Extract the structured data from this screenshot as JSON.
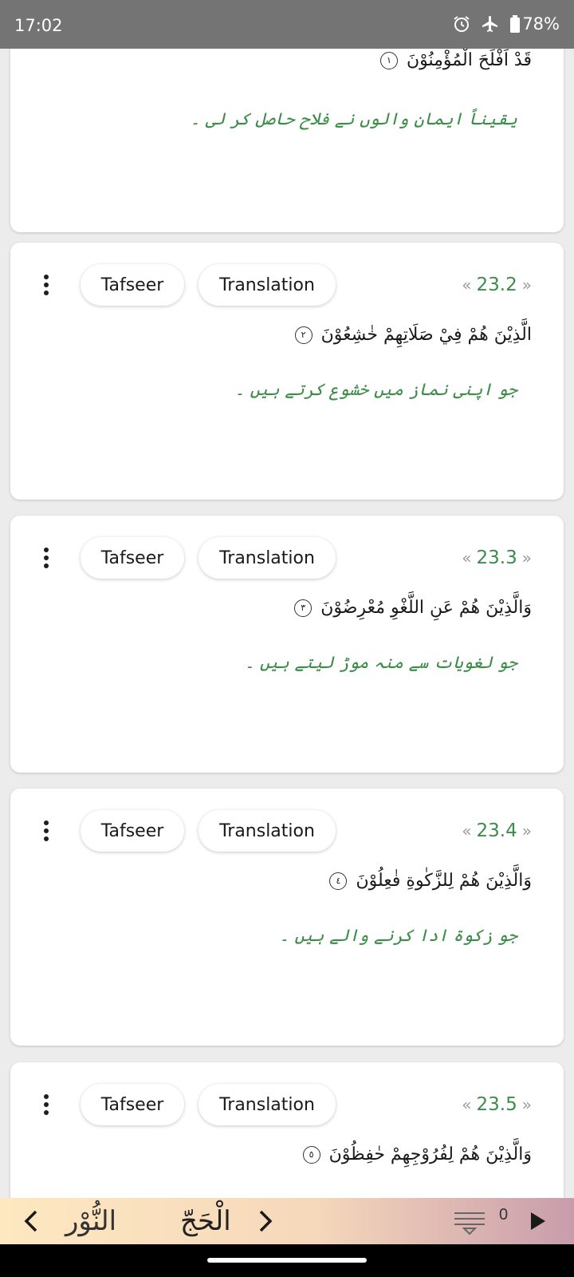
{
  "status_bar": {
    "time": "17:02",
    "battery": "78%",
    "icons": [
      "alarm-icon",
      "airplane-mode-icon",
      "battery-icon"
    ]
  },
  "colors": {
    "accent_green": "#3d8c4a",
    "status_bar_bg": "#747474",
    "page_bg": "#ececec"
  },
  "verses": [
    {
      "number": "",
      "arabic": "قَدْ اَفْلَحَ الْمُؤْمِنُوْنَ",
      "ayah_mark": "١",
      "urdu": "یقیناً ایمان والوں نے فلاح حاصل کر لی ۔"
    },
    {
      "number": "23.2",
      "tafseer_label": "Tafseer",
      "translation_label": "Translation",
      "arabic": "الَّذِيْنَ هُمْ فِيْ صَلَاتِهِمْ خٰشِعُوْنَ",
      "ayah_mark": "٢",
      "urdu": "جو اپنی نماز میں خشوع کرتے ہیں ۔"
    },
    {
      "number": "23.3",
      "tafseer_label": "Tafseer",
      "translation_label": "Translation",
      "arabic": "وَالَّذِيْنَ هُمْ عَنِ اللَّغْوِ مُعْرِضُوْنَ",
      "ayah_mark": "٣",
      "urdu": "جو لغویات سے منہ موڑ لیتے ہیں ۔"
    },
    {
      "number": "23.4",
      "tafseer_label": "Tafseer",
      "translation_label": "Translation",
      "arabic": "وَالَّذِيْنَ هُمْ لِلزَّكٰوةِ فٰعِلُوْنَ",
      "ayah_mark": "٤",
      "urdu": "جو زکوۃ ادا کرنے والے ہیں ۔"
    },
    {
      "number": "23.5",
      "tafseer_label": "Tafseer",
      "translation_label": "Translation",
      "arabic": "وَالَّذِيْنَ هُمْ لِفُرُوْجِهِمْ حٰفِظُوْنَ",
      "ayah_mark": "٥",
      "urdu": ""
    }
  ],
  "bottom_nav": {
    "previous_surah": "النُّوْر",
    "current_surah": "الْحَجّ",
    "playlist_count": "0",
    "icons": [
      "chevron-left-icon",
      "chevron-right-icon",
      "playlist-icon",
      "play-icon"
    ]
  }
}
